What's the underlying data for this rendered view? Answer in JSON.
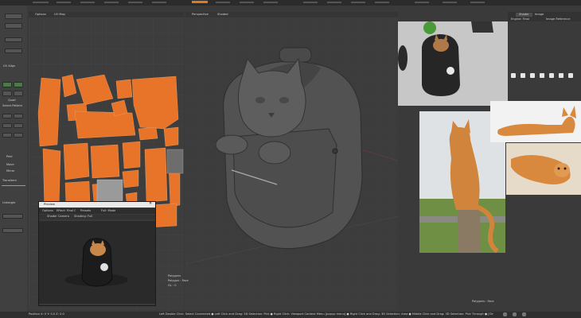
{
  "uv_view": {
    "tabs": [
      "Options",
      "UV Map"
    ]
  },
  "viewport": {
    "tabs": [
      "Perspective",
      "Shaded"
    ],
    "stats_left": [
      "Polygons",
      "Polygon : Face",
      "GL : 0"
    ],
    "stats_right": "Polygons : Face"
  },
  "preview_window": {
    "title": "Preview",
    "toolbar": [
      "Options",
      "Effect: Final Col...",
      "Presets",
      "Full: Mode"
    ],
    "subtabs": [
      "Shader Camera",
      "Shading: Full"
    ]
  },
  "left_toolbar": {
    "labels": [
      "UV Align",
      "Quad",
      "Select Pattern",
      "Peel",
      "Move",
      "Mirror",
      "Transform",
      "Untangle"
    ]
  },
  "right_panel": {
    "tabs": [
      "Shader",
      "Image"
    ],
    "fields": [
      "Engine: Final",
      "Image Reference"
    ]
  },
  "status_bar": {
    "left": "Position X:  0    Y: 0.0    Z: 0.0",
    "hints": "Left Double Click: Select Connected ● Left Click and Drag: 3D Selection: Pick ● Right Click: Viewport Context Menu [popup menu] ● Right Click and Drag: 3D Selection: Area ● Middle Click and Drag: 3D Selection: Pick Through ● [Ctrl] Right [Ctrl]-[Shift] Click and Drag..."
  },
  "colors": {
    "uv_orange": "#e8742a",
    "bg_dark": "#3a3a3a",
    "panel": "#444444",
    "accent": "#e07a22"
  }
}
